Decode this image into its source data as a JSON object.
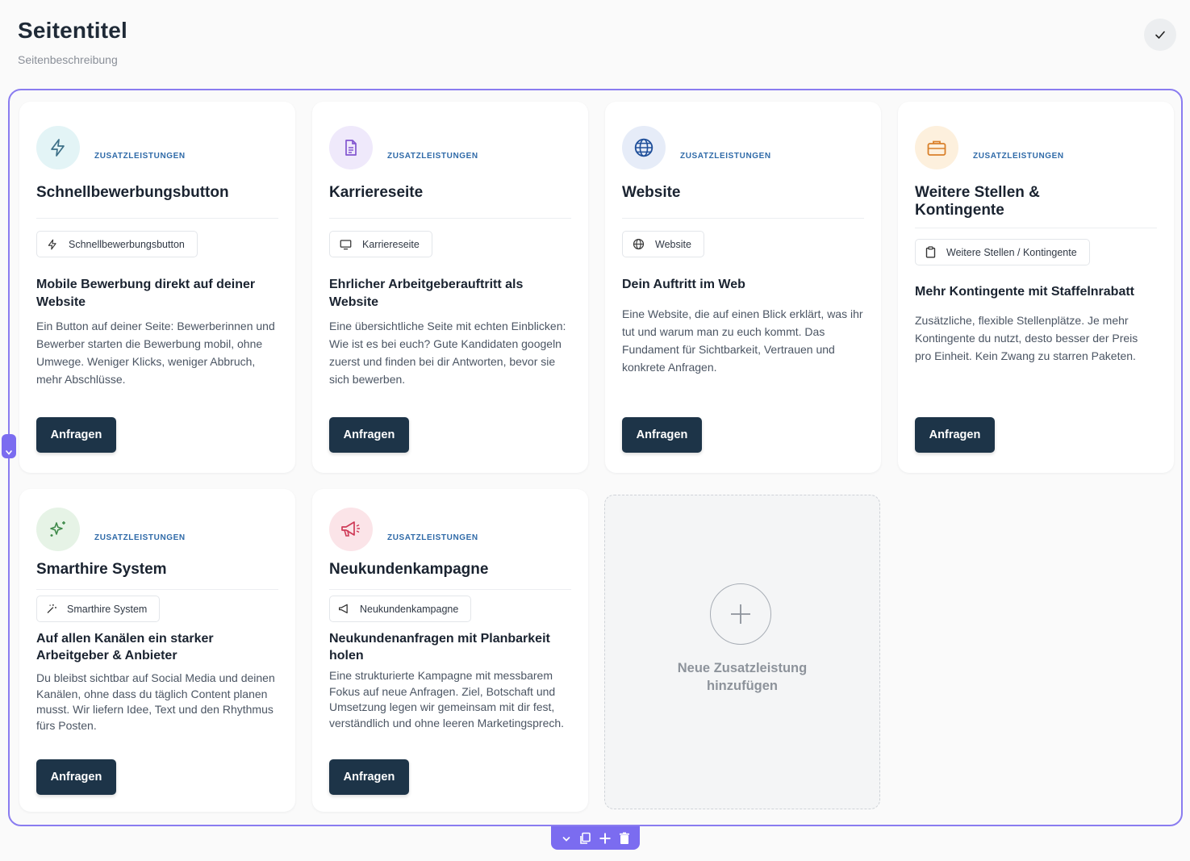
{
  "header": {
    "title": "Seitentitel",
    "subtitle": "Seitenbeschreibung"
  },
  "colors": {
    "accent": "#7b6cf0",
    "button": "#1d3448",
    "category": "#2f6aa8"
  },
  "cards": [
    {
      "icon": "lightning-icon",
      "category": "ZUSATZLEISTUNGEN",
      "title": "Schnellbewerbungsbutton",
      "chip_label": "Schnellbewerbungsbutton",
      "desc_title": "Mobile Bewerbung direkt auf deiner Website",
      "desc_text": "Ein Button auf deiner Seite: Bewerberinnen und Bewerber starten die Bewerbung mobil, ohne Umwege. Weniger Klicks, weniger Abbruch, mehr Abschlüsse.",
      "button_label": "Anfragen"
    },
    {
      "icon": "document-icon",
      "category": "ZUSATZLEISTUNGEN",
      "title": "Karriereseite",
      "chip_label": "Karriereseite",
      "desc_title": "Ehrlicher Arbeitgeberauftritt als Website",
      "desc_text": "Eine übersichtliche Seite mit echten Einblicken: Wie ist es bei euch? Gute Kandidaten googeln zuerst und finden bei dir Antworten, bevor sie sich bewerben.",
      "button_label": "Anfragen"
    },
    {
      "icon": "globe-icon",
      "category": "ZUSATZLEISTUNGEN",
      "title": "Website",
      "chip_label": "Website",
      "desc_title": "Dein Auftritt im Web",
      "desc_text": "Eine Website, die auf einen Blick erklärt, was ihr tut und warum man zu euch kommt. Das Fundament für Sichtbarkeit, Vertrauen und konkrete Anfragen.",
      "button_label": "Anfragen"
    },
    {
      "icon": "briefcase-icon",
      "category": "ZUSATZLEISTUNGEN",
      "title": "Weitere Stellen & Kontingente",
      "chip_label": "Weitere Stellen / Kontingente",
      "desc_title": "Mehr Kontingente mit Staffelnrabatt",
      "desc_text": "Zusätzliche, flexible Stellenplätze. Je mehr Kontingente du nutzt, desto besser der Preis pro Einheit. Kein Zwang zu starren Paketen.",
      "button_label": "Anfragen"
    },
    {
      "icon": "sparkle-icon",
      "category": "ZUSATZLEISTUNGEN",
      "title": "Smarthire System",
      "chip_label": "Smarthire System",
      "desc_title": "Auf allen Kanälen ein starker Arbeitgeber & Anbieter",
      "desc_text": "Du bleibst sichtbar auf Social Media und deinen Kanälen, ohne dass du täglich Content planen musst. Wir liefern Idee, Text und den Rhythmus fürs Posten.",
      "button_label": "Anfragen"
    },
    {
      "icon": "megaphone-icon",
      "category": "ZUSATZLEISTUNGEN",
      "title": "Neukundenkampagne",
      "chip_label": "Neukundenkampagne",
      "desc_title": "Neukundenanfragen mit Planbarkeit holen",
      "desc_text": "Eine strukturierte Kampagne mit messbarem Fokus auf neue Anfragen. Ziel, Botschaft und Umsetzung legen wir gemeinsam mit dir fest, verständlich und ohne leeren Marketingsprech.",
      "button_label": "Anfragen"
    }
  ],
  "add_card": {
    "label": "Neue Zusatzleistung hinzufügen"
  },
  "toolbar": {
    "items": [
      "chevron-down-icon",
      "duplicate-icon",
      "plus-icon",
      "trash-icon"
    ]
  }
}
